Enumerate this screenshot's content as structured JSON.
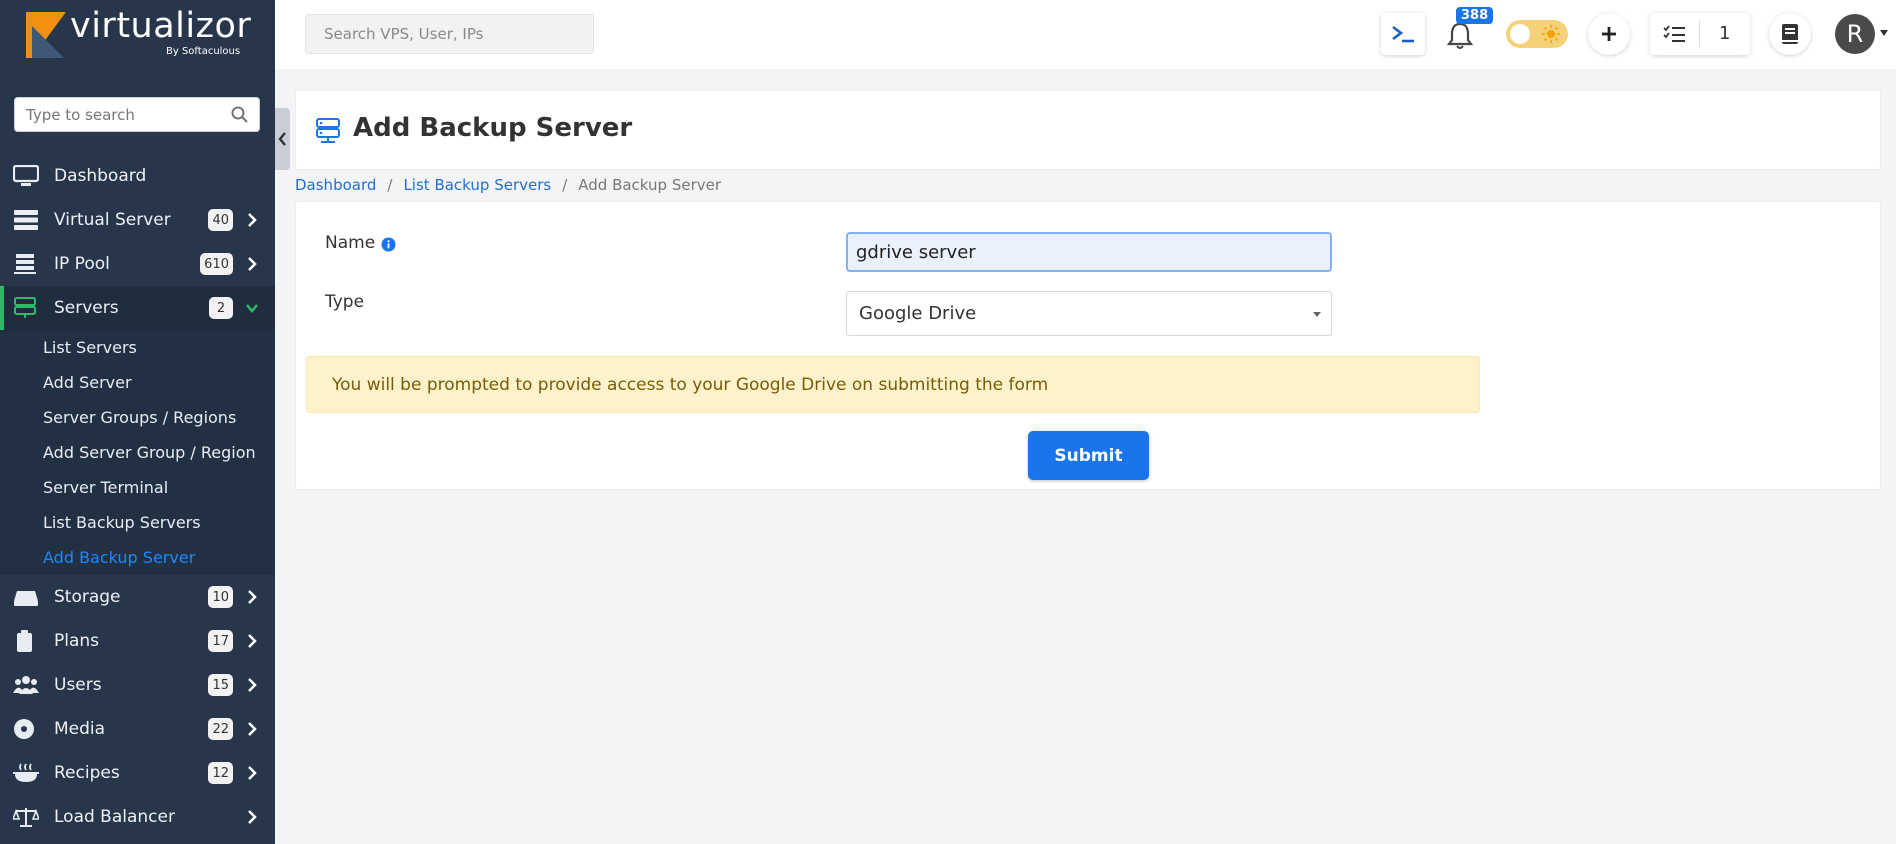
{
  "app": {
    "name": "virtualizor",
    "byline": "By Softaculous",
    "brand_color": "#f29111",
    "sidebar_bg": "#27364a",
    "accent": "#1a74ec"
  },
  "sidebar": {
    "search_placeholder": "Type to search",
    "items": [
      {
        "label": "Dashboard",
        "icon": "monitor-icon"
      },
      {
        "label": "Virtual Server",
        "badge": "40",
        "icon": "server-stack-icon"
      },
      {
        "label": "IP Pool",
        "badge": "610",
        "icon": "ip-pool-icon"
      },
      {
        "label": "Servers",
        "badge": "2",
        "icon": "servers-icon",
        "expanded": true
      },
      {
        "label": "Storage",
        "badge": "10",
        "icon": "storage-icon"
      },
      {
        "label": "Plans",
        "badge": "17",
        "icon": "clipboard-icon"
      },
      {
        "label": "Users",
        "badge": "15",
        "icon": "users-icon"
      },
      {
        "label": "Media",
        "badge": "22",
        "icon": "disc-icon"
      },
      {
        "label": "Recipes",
        "badge": "12",
        "icon": "recipe-icon"
      },
      {
        "label": "Load Balancer",
        "icon": "balance-icon"
      }
    ],
    "servers_sub": [
      "List Servers",
      "Add Server",
      "Server Groups / Regions",
      "Add Server Group / Region",
      "Server Terminal",
      "List Backup Servers",
      "Add Backup Server"
    ]
  },
  "topbar": {
    "search_placeholder": "Search VPS, User, IPs",
    "notifications_count": "388",
    "tasks_count": "1",
    "avatar_letter": "R",
    "theme_mode": "light"
  },
  "page": {
    "title": "Add Backup Server",
    "breadcrumb": [
      "Dashboard",
      "List Backup Servers",
      "Add Backup Server"
    ]
  },
  "form": {
    "name_label": "Name",
    "name_value": "gdrive server",
    "type_label": "Type",
    "type_value": "Google Drive",
    "notice": "You will be prompted to provide access to your Google Drive on submitting the form",
    "submit_label": "Submit"
  }
}
